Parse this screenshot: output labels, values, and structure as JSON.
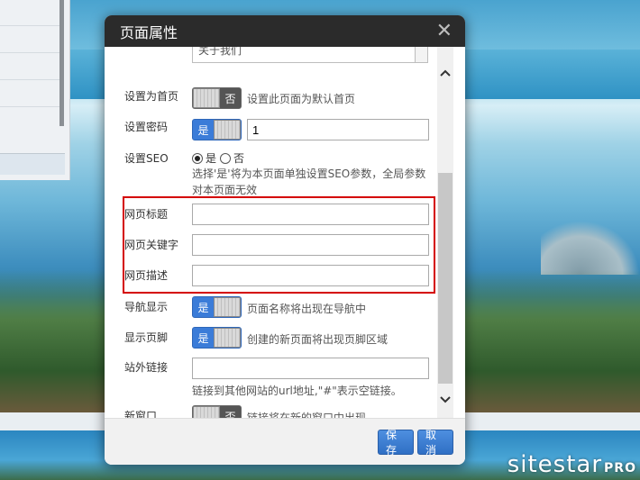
{
  "background": {
    "brand_text": "sitestar",
    "brand_suffix": "PRO"
  },
  "dialog": {
    "title": "页面属性",
    "close_label": "✕",
    "partial_top_value": "关于我们",
    "fields": {
      "homepage": {
        "label": "设置为首页",
        "toggle": "否",
        "help": "设置此页面为默认首页"
      },
      "password": {
        "label": "设置密码",
        "toggle": "是",
        "value": "1"
      },
      "seo": {
        "label": "设置SEO",
        "option_yes": "是",
        "option_no": "否",
        "selected": "是",
        "help": "选择'是'将为本页面单独设置SEO参数，全局参数对本页面无效"
      },
      "page_title": {
        "label": "网页标题",
        "value": ""
      },
      "keywords": {
        "label": "网页关键字",
        "value": ""
      },
      "description": {
        "label": "网页描述",
        "value": ""
      },
      "nav_display": {
        "label": "导航显示",
        "toggle": "是",
        "help": "页面名称将出现在导航中"
      },
      "footer_display": {
        "label": "显示页脚",
        "toggle": "是",
        "help": "创建的新页面将出现页脚区域"
      },
      "external_link": {
        "label": "站外链接",
        "value": "",
        "help": "链接到其他网站的url地址,\"#\"表示空链接。"
      },
      "new_window": {
        "label": "新窗口",
        "toggle": "否",
        "help": "链接将在新的窗口中出现"
      }
    },
    "buttons": {
      "save": "保存",
      "cancel": "取消"
    }
  },
  "colors": {
    "accent": "#3b7cd8",
    "header": "#2b2b2b",
    "highlight": "#d40000"
  }
}
